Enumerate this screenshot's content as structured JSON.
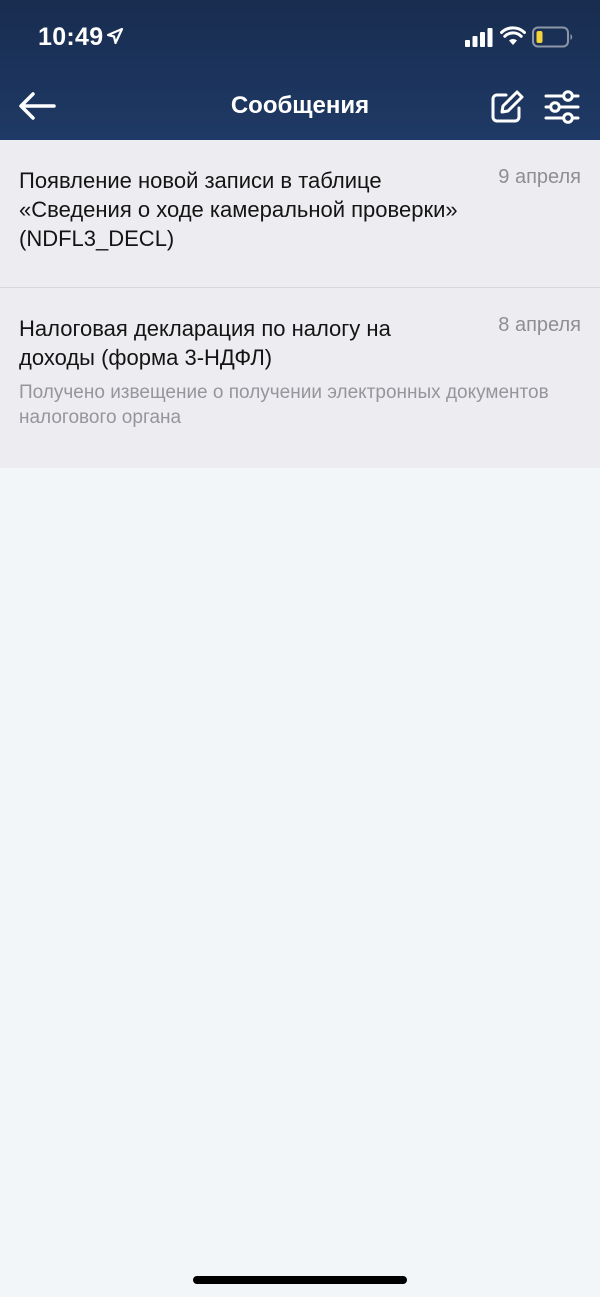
{
  "status_bar": {
    "time": "10:49",
    "icons": [
      "location-arrow-icon",
      "cellular-signal-icon",
      "wifi-icon",
      "battery-low-icon"
    ],
    "battery_color": "#f5d33a"
  },
  "header": {
    "title": "Сообщения",
    "back_icon": "back-arrow-icon",
    "compose_icon": "compose-icon",
    "filter_icon": "filter-sliders-icon",
    "background_color": "#1a3158"
  },
  "messages": [
    {
      "title": "Появление новой записи в таблице «Сведения о ходе камеральной проверки» (NDFL3_DECL)",
      "date": "9 апреля",
      "preview": ""
    },
    {
      "title": "Налоговая декларация по налогу на доходы (форма 3-НДФЛ)",
      "date": "8 апреля",
      "preview": "Получено извещение о получении электронных документов налогового органа"
    }
  ]
}
